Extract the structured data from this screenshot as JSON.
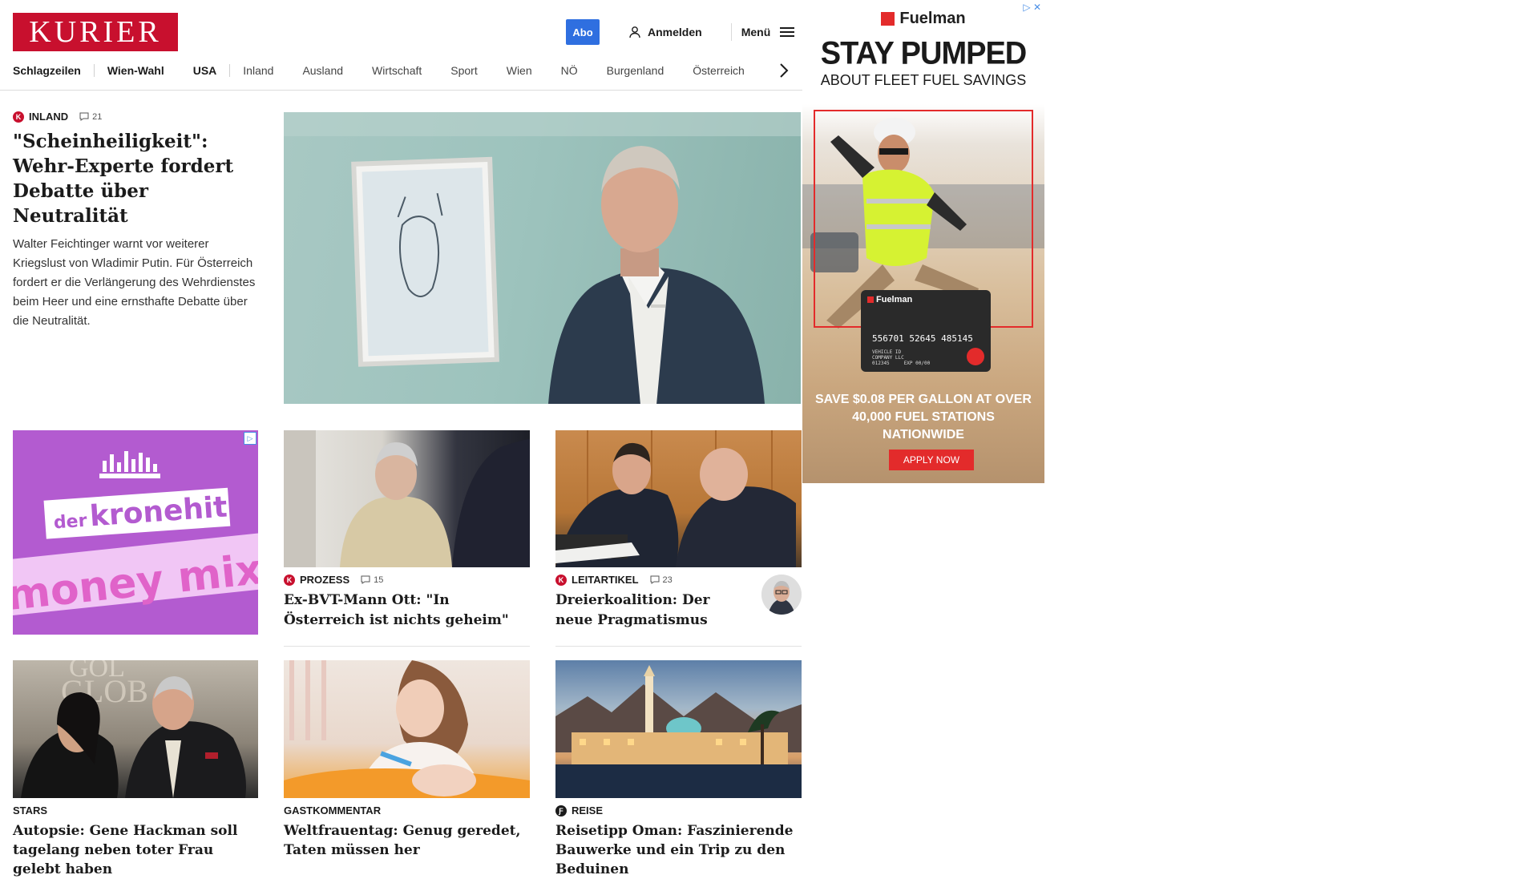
{
  "header": {
    "logo": "KURIER",
    "abo_label": "Abo",
    "login_label": "Anmelden",
    "menu_label": "Menü"
  },
  "nav": {
    "items": [
      "Schlagzeilen",
      "Wien-Wahl",
      "USA",
      "Inland",
      "Ausland",
      "Wirtschaft",
      "Sport",
      "Wien",
      "NÖ",
      "Burgenland",
      "Österreich"
    ]
  },
  "lead": {
    "kicker": "INLAND",
    "comments": "21",
    "headline": "\"Scheinheiligkeit\": Wehr-Experte fordert Debatte über Neutralität",
    "teaser": "Walter Feichtinger warnt vor weiterer Kriegslust von Wladimir Putin. Für Österreich fordert er die Verlängerung des Wehrdienstes beim Heer und eine ernsthafte Debatte über die Neutralität."
  },
  "inline_ad": {
    "brand_left": "der",
    "brand_right": "kronehit",
    "tagline": "money mix"
  },
  "cards": [
    {
      "kicker": "PROZESS",
      "comments": "15",
      "headline": "Ex-BVT-Mann Ott: \"In Österreich ist nichts geheim\""
    },
    {
      "kicker": "LEITARTIKEL",
      "comments": "23",
      "headline": "Dreierkoalition: Der neue Pragmatismus"
    },
    {
      "kicker": "STARS",
      "comments": "",
      "headline": "Autopsie: Gene Hackman soll tagelang neben toter Frau gelebt haben"
    },
    {
      "kicker": "GASTKOMMENTAR",
      "comments": "",
      "headline": "Weltfrauentag: Genug geredet, Taten müssen her"
    },
    {
      "kicker": "REISE",
      "comments": "",
      "headline": "Reisetipp Oman: Faszinierende Bauwerke und ein Trip zu den Beduinen"
    }
  ],
  "side_ad": {
    "brand": "Fuelman",
    "headline": "STAY PUMPED",
    "subheadline": "ABOUT FLEET FUEL SAVINGS",
    "card_brand": "Fuelman",
    "card_number": "556701 52645 485145",
    "card_line1": "VEHICLE ID",
    "card_line2": "COMPANY LLC",
    "card_line3": "012345",
    "card_exp": "EXP 00/00",
    "offer": "SAVE $0.08 PER GALLON AT OVER 40,000 FUEL STATIONS NATIONWIDE",
    "cta": "APPLY NOW"
  },
  "colors": {
    "brand_red": "#c8102e",
    "abo_blue": "#2f6fe0",
    "ad_purple": "#b35bd0",
    "ad_red": "#e32b2b"
  }
}
